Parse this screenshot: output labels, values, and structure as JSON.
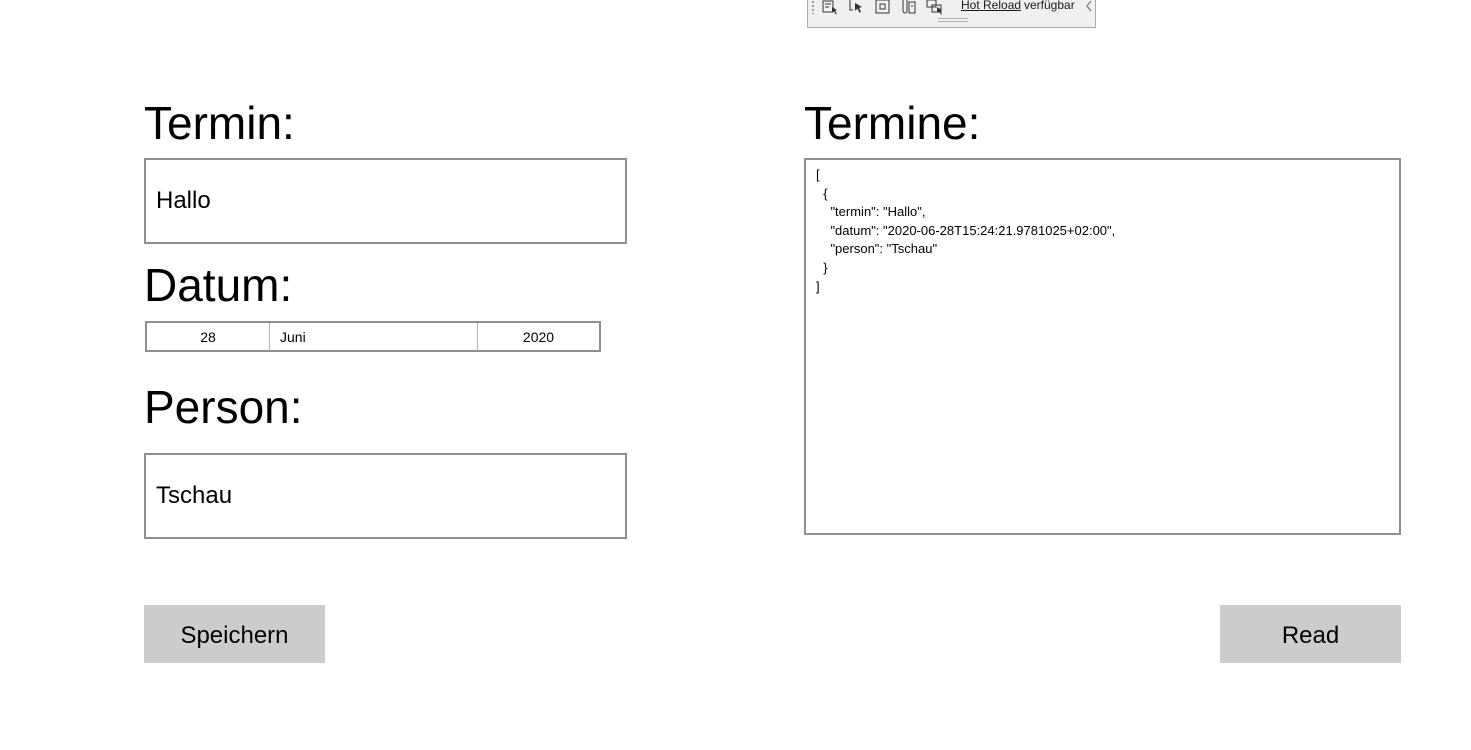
{
  "debug_toolbar": {
    "icons": [
      "element-tree-icon",
      "select-element-icon",
      "display-layout-adorners-icon",
      "track-focus-icon",
      "binding-failures-icon"
    ],
    "hot_reload_link": "Hot Reload",
    "hot_reload_status": "verfügbar"
  },
  "form": {
    "termin_label": "Termin:",
    "termin_value": "Hallo",
    "datum_label": "Datum:",
    "datum": {
      "day": "28",
      "month": "Juni",
      "year": "2020"
    },
    "person_label": "Person:",
    "person_value": "Tschau",
    "save_label": "Speichern"
  },
  "output": {
    "termine_label": "Termine:",
    "json_text": "[\n  {\n    \"termin\": \"Hallo\",\n    \"datum\": \"2020-06-28T15:24:21.9781025+02:00\",\n    \"person\": \"Tschau\"\n  }\n]",
    "read_label": "Read"
  }
}
